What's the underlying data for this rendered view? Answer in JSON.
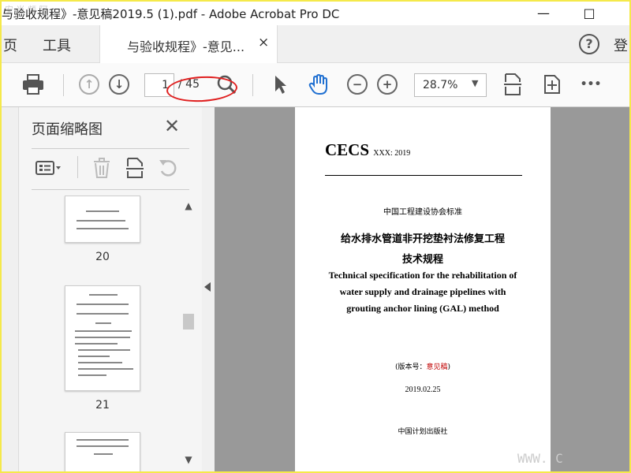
{
  "window": {
    "title": "与验收规程》-意见稿2019.5 (1).pdf - Adobe Acrobat Pro DC",
    "minimize_label": "—",
    "maximize_label": "□",
    "corner_watermark": "安 当 频 阿"
  },
  "menubar": {
    "home_label": "页",
    "tools_label": "工具",
    "document_tab": "与验收规程》-意见...",
    "tab_close": "×",
    "help_label": "?",
    "login_label": "登"
  },
  "toolbar": {
    "current_page": "1",
    "total_pages": "/ 45",
    "zoom": "28.7%",
    "zoom_caret": "▼",
    "more_label": "•••",
    "annotation_color": "#e02020"
  },
  "thumbnail_panel": {
    "title": "页面缩略图",
    "close_label": "✕",
    "pages": [
      {
        "number": "20"
      },
      {
        "number": "21"
      }
    ],
    "scroll_up": "▲",
    "scroll_down": "▼"
  },
  "document": {
    "cecs": "CECS",
    "cecs_number": "XXX: 2019",
    "standard_type": "中国工程建设协会标准",
    "title_cn_line1": "给水排水管道非开挖垫衬法修复工程",
    "title_cn_line2": "技术规程",
    "title_en_line1": "Technical specification for the rehabilitation of",
    "title_en_line2": "water supply and drainage pipelines with",
    "title_en_line3": "grouting anchor lining (GAL) method",
    "version_prefix": "(版本号：",
    "version_value": "意见稿",
    "version_suffix": ")",
    "date": "2019.02.25",
    "publisher": "中国计划出版社",
    "watermark": "WWW. C"
  },
  "colors": {
    "frame_border": "#f5e94a",
    "document_background": "#999999",
    "hand_tool_active": "#1f6fd1",
    "version_red": "#c00000"
  }
}
